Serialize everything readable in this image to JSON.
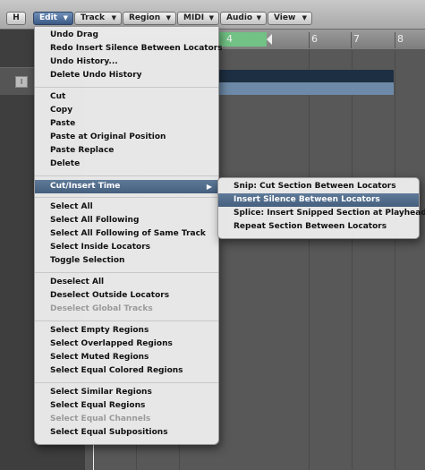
{
  "toolbar": {
    "h_button": "H",
    "menus": [
      {
        "label": "Edit",
        "arrow": "▼"
      },
      {
        "label": "Track",
        "arrow": "▼"
      },
      {
        "label": "Region",
        "arrow": "▼"
      },
      {
        "label": "MIDI",
        "arrow": "▼"
      },
      {
        "label": "Audio",
        "arrow": "▼"
      },
      {
        "label": "View",
        "arrow": "▼"
      }
    ]
  },
  "ruler": {
    "numbers": [
      "4",
      "6",
      "7",
      "8"
    ]
  },
  "track": {
    "i_button": "I"
  },
  "edit_menu": {
    "groups": [
      [
        {
          "label": "Undo Drag"
        },
        {
          "label": "Redo Insert Silence Between Locators"
        },
        {
          "label": "Undo History..."
        },
        {
          "label": "Delete Undo History"
        }
      ],
      [
        {
          "label": "Cut"
        },
        {
          "label": "Copy"
        },
        {
          "label": "Paste"
        },
        {
          "label": "Paste at Original Position"
        },
        {
          "label": "Paste Replace"
        },
        {
          "label": "Delete"
        }
      ],
      [
        {
          "label": "Cut/Insert Time",
          "submenu_arrow": "▶",
          "highlighted": true
        }
      ],
      [
        {
          "label": "Select All"
        },
        {
          "label": "Select All Following"
        },
        {
          "label": "Select All Following of Same Track"
        },
        {
          "label": "Select Inside Locators"
        },
        {
          "label": "Toggle Selection"
        }
      ],
      [
        {
          "label": "Deselect All"
        },
        {
          "label": "Deselect Outside Locators"
        },
        {
          "label": "Deselect Global Tracks",
          "disabled": true
        }
      ],
      [
        {
          "label": "Select Empty Regions"
        },
        {
          "label": "Select Overlapped Regions"
        },
        {
          "label": "Select Muted Regions"
        },
        {
          "label": "Select Equal Colored Regions"
        }
      ],
      [
        {
          "label": "Select Similar Regions"
        },
        {
          "label": "Select Equal Regions"
        },
        {
          "label": "Select Equal Channels",
          "disabled": true
        },
        {
          "label": "Select Equal Subpositions"
        }
      ]
    ]
  },
  "submenu": {
    "items": [
      {
        "label": "Snip: Cut Section Between Locators"
      },
      {
        "label": "Insert Silence Between Locators",
        "highlighted": true
      },
      {
        "label": "Splice: Insert Snipped Section at Playhead"
      },
      {
        "label": "Repeat Section Between Locators"
      }
    ]
  },
  "colors": {
    "highlight": "#4f6a8a",
    "cycle_region": "#71c284",
    "region_blue": "#6d8aa8"
  }
}
